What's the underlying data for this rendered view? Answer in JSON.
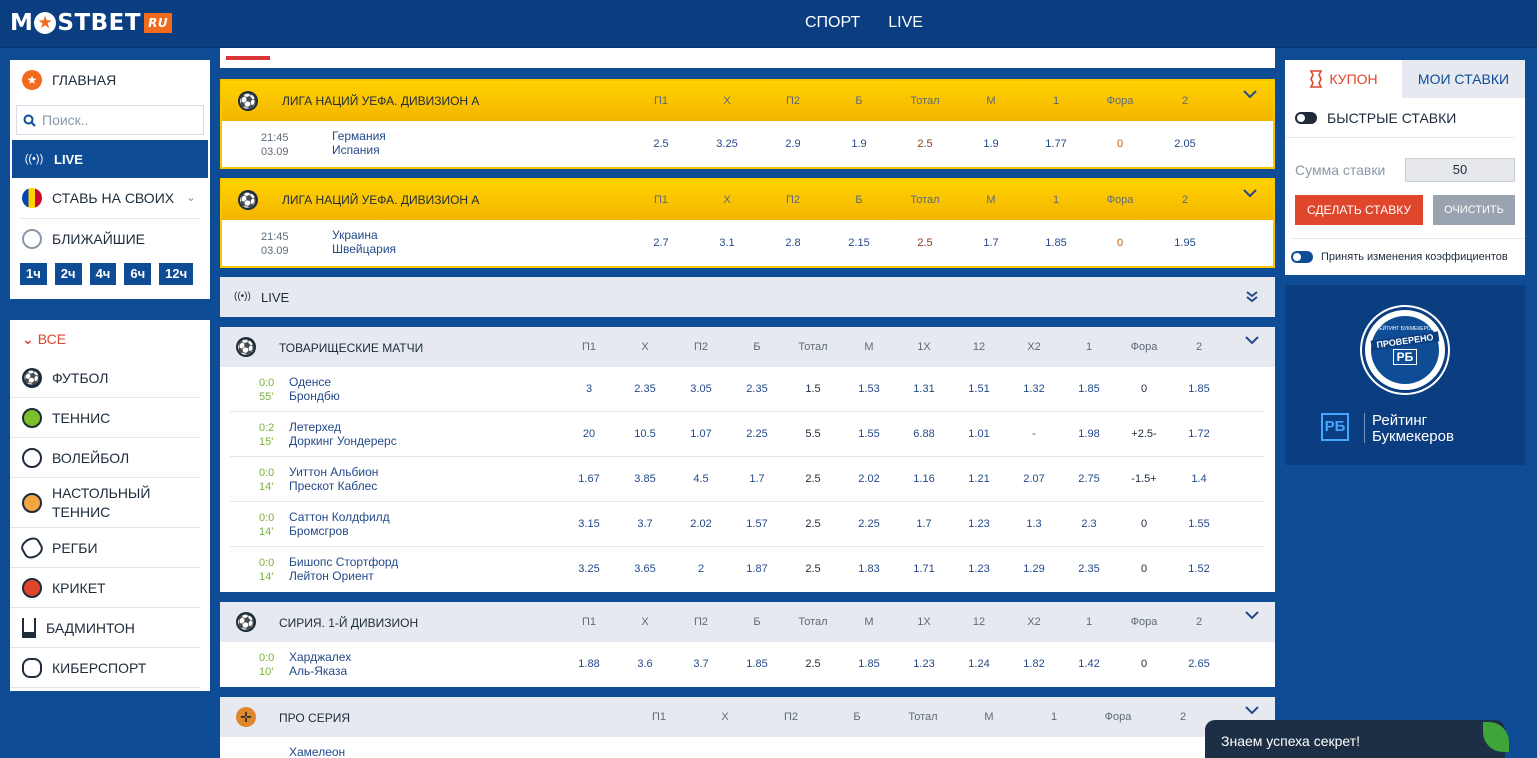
{
  "header": {
    "logo": "M★STBET",
    "logo_star": "★",
    "logo_text_a": "M",
    "logo_text_b": "STBET",
    "logo_ru": "RU",
    "nav": [
      "СПОРТ",
      "LIVE"
    ]
  },
  "sidebar": {
    "home": "ГЛАВНАЯ",
    "search_placeholder": "Поиск..",
    "live": "LIVE",
    "local": "СТАВЬ НА СВОИХ",
    "upcoming": "БЛИЖАЙШИЕ",
    "hours": [
      "1ч",
      "2ч",
      "4ч",
      "6ч",
      "12ч"
    ],
    "all": "ВСЕ",
    "sports": [
      "ФУТБОЛ",
      "ТЕННИС",
      "ВОЛЕЙБОЛ",
      "НАСТОЛЬНЫЙ ТЕННИС",
      "РЕГБИ",
      "КРИКЕТ",
      "БАДМИНТОН",
      "КИБЕРСПОРТ"
    ]
  },
  "featured": [
    {
      "title": "ЛИГА НАЦИЙ УЕФА. ДИВИЗИОН А",
      "time": "21:45",
      "date": "03.09",
      "team1": "Германия",
      "team2": "Испания",
      "odds": [
        "2.5",
        "3.25",
        "2.9",
        "1.9",
        "2.5",
        "1.9",
        "1.77",
        "0",
        "2.05"
      ]
    },
    {
      "title": "ЛИГА НАЦИЙ УЕФА. ДИВИЗИОН А",
      "time": "21:45",
      "date": "03.09",
      "team1": "Украина",
      "team2": "Швейцария",
      "odds": [
        "2.7",
        "3.1",
        "2.8",
        "2.15",
        "2.5",
        "1.7",
        "1.85",
        "0",
        "1.95"
      ]
    }
  ],
  "cols9": [
    "П1",
    "Х",
    "П2",
    "Б",
    "Тотал",
    "М",
    "1",
    "Фора",
    "2"
  ],
  "cols12": [
    "П1",
    "Х",
    "П2",
    "Б",
    "Тотал",
    "М",
    "1Х",
    "12",
    "Х2",
    "1",
    "Фора",
    "2"
  ],
  "live_label": "LIVE",
  "friendly": {
    "title": "ТОВАРИЩЕСКИЕ МАТЧИ",
    "rows": [
      {
        "score": "0:0",
        "min": "55'",
        "team1": "Оденсе",
        "team2": "Брондбю",
        "odds": [
          "3",
          "2.35",
          "3.05",
          "2.35",
          "1.5",
          "1.53",
          "1.31",
          "1.51",
          "1.32",
          "1.85",
          "0",
          "1.85"
        ]
      },
      {
        "score": "0:2",
        "min": "15'",
        "team1": "Летерхед",
        "team2": "Доркинг Уондерерс",
        "odds": [
          "20",
          "10.5",
          "1.07",
          "2.25",
          "5.5",
          "1.55",
          "6.88",
          "1.01",
          "-",
          "1.98",
          "+2.5-",
          "1.72"
        ]
      },
      {
        "score": "0:0",
        "min": "14'",
        "team1": "Уиттон Альбион",
        "team2": "Прескот Каблес",
        "odds": [
          "1.67",
          "3.85",
          "4.5",
          "1.7",
          "2.5",
          "2.02",
          "1.16",
          "1.21",
          "2.07",
          "2.75",
          "-1.5+",
          "1.4"
        ]
      },
      {
        "score": "0:0",
        "min": "14'",
        "team1": "Саттон Колдфилд",
        "team2": "Бромсгров",
        "odds": [
          "3.15",
          "3.7",
          "2.02",
          "1.57",
          "2.5",
          "2.25",
          "1.7",
          "1.23",
          "1.3",
          "2.3",
          "0",
          "1.55"
        ]
      },
      {
        "score": "0:0",
        "min": "14'",
        "team1": "Бишопс Стортфорд",
        "team2": "Лейтон Ориент",
        "odds": [
          "3.25",
          "3.65",
          "2",
          "1.87",
          "2.5",
          "1.83",
          "1.71",
          "1.23",
          "1.29",
          "2.35",
          "0",
          "1.52"
        ]
      }
    ]
  },
  "syria": {
    "title": "СИРИЯ. 1-Й ДИВИЗИОН",
    "rows": [
      {
        "score": "0:0",
        "min": "10'",
        "team1": "Харджалех",
        "team2": "Аль-Яказа",
        "odds": [
          "1.88",
          "3.6",
          "3.7",
          "1.85",
          "2.5",
          "1.85",
          "1.23",
          "1.24",
          "1.82",
          "1.42",
          "0",
          "2.65"
        ]
      }
    ]
  },
  "proseries": {
    "title": "ПРО СЕРИЯ",
    "team1": "Хамелеон"
  },
  "coupon": {
    "tab_coupon": "КУПОН",
    "tab_mybets": "МОИ СТАВКИ",
    "quick": "БЫСТРЫЕ СТАВКИ",
    "amount_label": "Сумма ставки",
    "amount_value": "50",
    "bet_button": "СДЕЛАТЬ СТАВКУ",
    "clear_button": "ОЧИСТИТЬ",
    "accept": "Принять изменения коэффициентов"
  },
  "promo": {
    "seal_top": "РЕЙТИНГ БУКМЕКЕРОВ",
    "seal_mid": "ПРОВЕРЕНО",
    "seal_rb": "РБ",
    "logo_rb": "РБ",
    "line1": "Рейтинг",
    "line2": "Букмекеров"
  },
  "toast": "Знаем успеха секрет!"
}
